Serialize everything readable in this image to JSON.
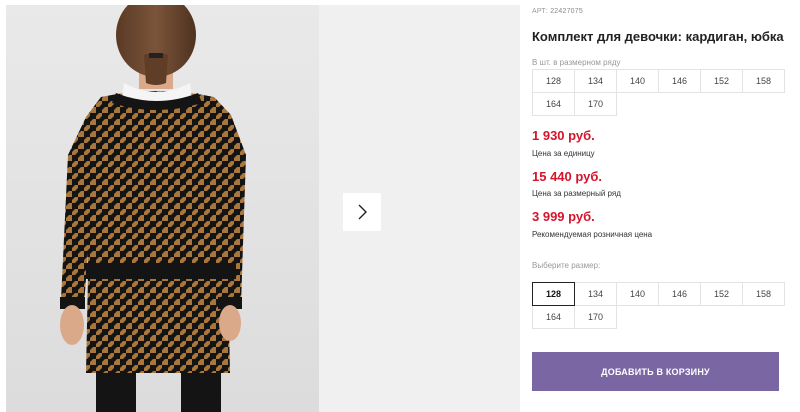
{
  "product": {
    "art_prefix": "АРТ:",
    "art_number": "22427075",
    "title": "Комплект для девочки: кардиган, юбка"
  },
  "row_sizes": {
    "label": "В шт. в размерном ряду",
    "sizes": [
      "128",
      "134",
      "140",
      "146",
      "152",
      "158",
      "164",
      "170"
    ]
  },
  "prices": [
    {
      "value": "1 930 руб.",
      "label": "Цена за единицу"
    },
    {
      "value": "15 440 руб.",
      "label": "Цена за размерный ряд"
    },
    {
      "value": "3 999 руб.",
      "label": "Рекомендуемая розничная цена"
    }
  ],
  "size_select": {
    "label": "Выберите размер:",
    "sizes": [
      "128",
      "134",
      "140",
      "146",
      "152",
      "158",
      "164",
      "170"
    ],
    "selected": "128"
  },
  "cart_button": {
    "label": "ДОБАВИТЬ В КОРЗИНУ"
  },
  "gallery": {
    "next_icon": "chevron-right-icon"
  },
  "colors": {
    "price": "#d5142b",
    "cart_button": "#7a66a3",
    "houndstooth_light": "#a9763b",
    "houndstooth_dark": "#141414"
  }
}
